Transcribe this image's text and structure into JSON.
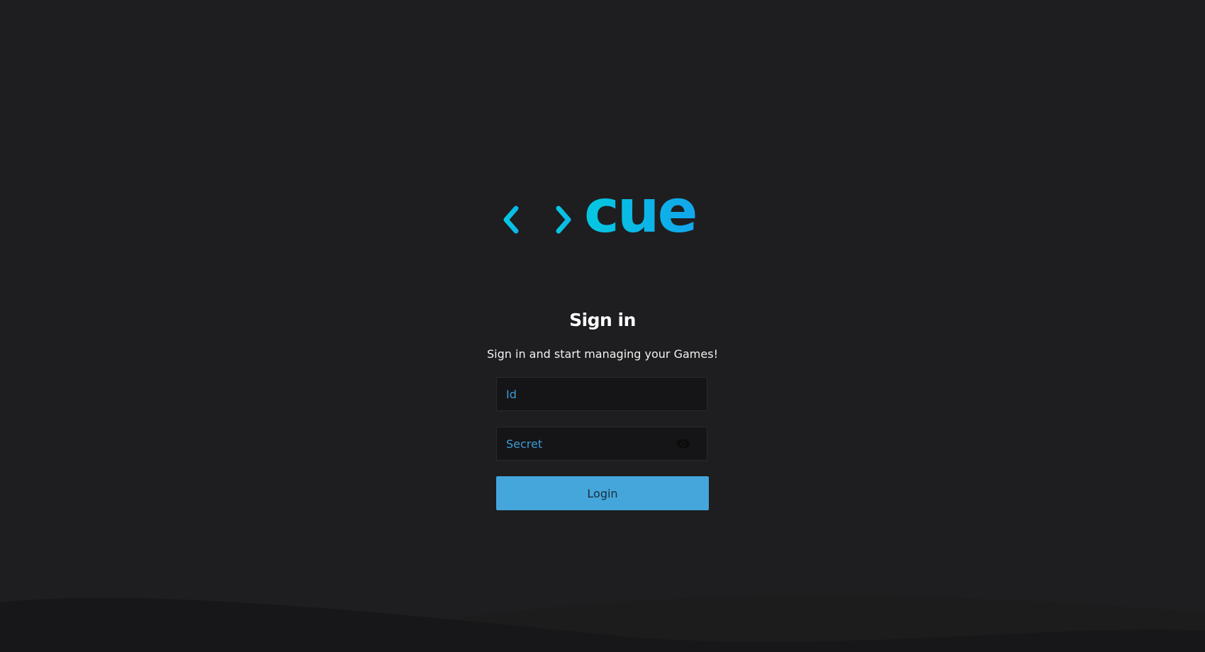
{
  "brand": {
    "logo_text": "cue",
    "gradient_start": "#04c8e0",
    "gradient_end": "#12a6ec"
  },
  "signin": {
    "title": "Sign in",
    "subtitle": "Sign in and start managing your Games!",
    "id_placeholder": "Id",
    "id_value": "",
    "secret_placeholder": "Secret",
    "secret_value": "",
    "toggle_icon": "eye-icon",
    "login_label": "Login"
  },
  "colors": {
    "background": "#1e1e20",
    "input_background": "#151517",
    "placeholder": "#3e9ad6",
    "button": "#44a6da",
    "button_text": "#1a2e3c"
  }
}
